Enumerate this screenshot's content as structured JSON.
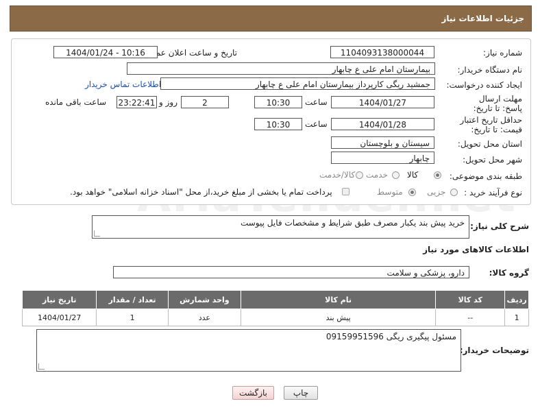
{
  "header": {
    "title": "جزئیات اطلاعات نیاز"
  },
  "form": {
    "need_number_label": "شماره نیاز:",
    "need_number": "1104093138000044",
    "announce_label": "تاریخ و ساعت اعلان عمومی:",
    "announce_value": "1404/01/24 - 10:16",
    "buyer_org_label": "نام دستگاه خریدار:",
    "buyer_org": "بیمارستان امام علی  ع  چابهار",
    "creator_label": "ایجاد کننده درخواست:",
    "creator": "جمشید ریگی کارپرداز بیمارستان امام علی  ع  چابهار",
    "contact_link": "اطلاعات تماس خریدار",
    "deadline_label": "مهلت ارسال پاسخ: تا تاریخ:",
    "deadline_date": "1404/01/27",
    "time_label": "ساعت",
    "deadline_time": "10:30",
    "days_value": "2",
    "days_label": "روز و",
    "remaining_time": "23:22:41",
    "remaining_label": "ساعت باقی مانده",
    "validity_label": "حداقل تاریخ اعتبار قیمت: تا تاریخ:",
    "validity_date": "1404/01/28",
    "validity_time": "10:30",
    "province_label": "استان محل تحویل:",
    "province": "سیستان و بلوچستان",
    "city_label": "شهر محل تحویل:",
    "city": "چابهار",
    "category_label": "طبقه بندی موضوعی:",
    "category_options": [
      "کالا",
      "خدمت",
      "کالا/خدمت"
    ],
    "category_selected": "کالا",
    "process_label": "نوع فرآیند خرید :",
    "process_options": [
      "جزیی",
      "متوسط"
    ],
    "process_selected": "متوسط",
    "payment_note": "پرداخت تمام یا بخشی از مبلغ خرید،از محل \"اسناد خزانه اسلامی\" خواهد بود."
  },
  "description": {
    "label": "شرح کلی نیاز:",
    "value": "خرید پیش بند یکبار مصرف طبق شرایط و مشخصات فایل پیوست"
  },
  "goods": {
    "section_title": "اطلاعات کالاهای مورد نیاز",
    "group_label": "گروه کالا:",
    "group_value": "دارو، پزشکی و سلامت",
    "columns": [
      "ردیف",
      "کد کالا",
      "نام کالا",
      "واحد شمارش",
      "تعداد / مقدار",
      "تاریخ نیاز"
    ],
    "rows": [
      {
        "row": "1",
        "code": "--",
        "name": "پیش بند",
        "unit": "عدد",
        "qty": "1",
        "date": "1404/01/27"
      }
    ]
  },
  "buyer_notes": {
    "label": "توضیحات خریدار:",
    "value": "مسئول پیگیری ریگی 09159951596"
  },
  "buttons": {
    "print": "چاپ",
    "back": "بازگشت"
  },
  "watermark": "AriaTender.net",
  "colors": {
    "header_bg": "#8b6b47",
    "table_header_bg": "#6b6b6b",
    "link": "#1a4fb0"
  }
}
